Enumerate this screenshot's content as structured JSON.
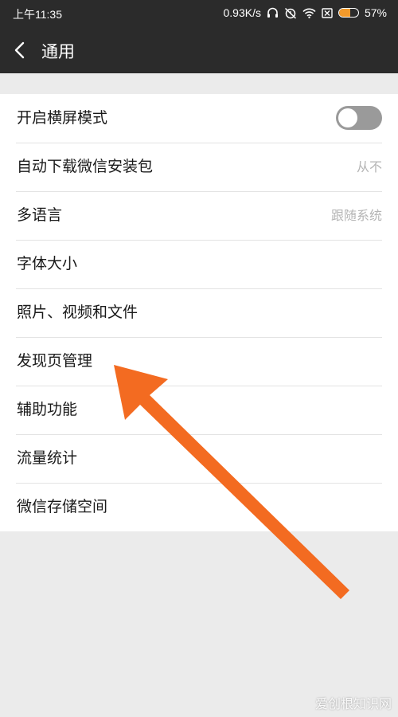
{
  "status_bar": {
    "time": "上午11:35",
    "speed": "0.93K/s",
    "battery_percent": "57%",
    "battery_level": 0.57,
    "icons": [
      "headphones-icon",
      "alarm-off-icon",
      "wifi-icon",
      "no-sim-icon",
      "battery-icon"
    ]
  },
  "header": {
    "title": "通用",
    "back_icon": "chevron-left-icon"
  },
  "settings": {
    "items": [
      {
        "label": "开启横屏模式",
        "control": "toggle",
        "toggle_on": false
      },
      {
        "label": "自动下载微信安装包",
        "value": "从不"
      },
      {
        "label": "多语言",
        "value": "跟随系统"
      },
      {
        "label": "字体大小"
      },
      {
        "label": "照片、视频和文件"
      },
      {
        "label": "发现页管理"
      },
      {
        "label": "辅助功能"
      },
      {
        "label": "流量统计"
      },
      {
        "label": "微信存储空间"
      }
    ]
  },
  "annotation": {
    "arrow_color": "#f36b21",
    "points_to": "发现页管理"
  },
  "watermark": {
    "text": "爱创根知识网"
  },
  "colors": {
    "header_bg": "#2b2b2b",
    "page_bg": "#ebebeb",
    "accent_arrow": "#f36b21",
    "toggle_off": "#9a9a9a"
  }
}
